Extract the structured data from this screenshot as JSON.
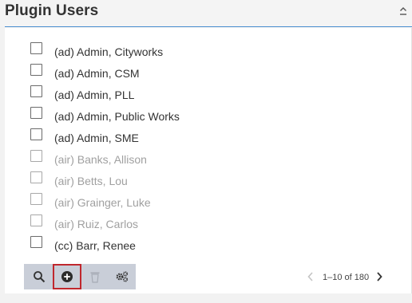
{
  "panel": {
    "title": "Plugin Users",
    "collapse_icon": "chevron-up-icon"
  },
  "users": [
    {
      "label": "(ad) Admin, Cityworks",
      "enabled": true,
      "checked": false
    },
    {
      "label": "(ad) Admin, CSM",
      "enabled": true,
      "checked": false
    },
    {
      "label": "(ad) Admin, PLL",
      "enabled": true,
      "checked": false
    },
    {
      "label": "(ad) Admin, Public Works",
      "enabled": true,
      "checked": false
    },
    {
      "label": "(ad) Admin, SME",
      "enabled": true,
      "checked": false
    },
    {
      "label": "(air) Banks, Allison",
      "enabled": false,
      "checked": false
    },
    {
      "label": "(air) Betts, Lou",
      "enabled": false,
      "checked": false
    },
    {
      "label": "(air) Grainger, Luke",
      "enabled": false,
      "checked": false
    },
    {
      "label": "(air) Ruiz, Carlos",
      "enabled": false,
      "checked": false
    },
    {
      "label": "(cc) Barr, Renee",
      "enabled": true,
      "checked": false
    }
  ],
  "toolbar": {
    "buttons": [
      {
        "icon": "search-icon"
      },
      {
        "icon": "add-circle-icon"
      },
      {
        "icon": "trash-icon"
      },
      {
        "icon": "settings-gears-icon"
      }
    ]
  },
  "pager": {
    "range_text": "1–10 of 180"
  },
  "colors": {
    "accent_rule": "#4a8fd0",
    "toolbar_bg": "#c9ced8",
    "active_outline": "#c0272d",
    "disabled_text": "#a0a0a0"
  }
}
